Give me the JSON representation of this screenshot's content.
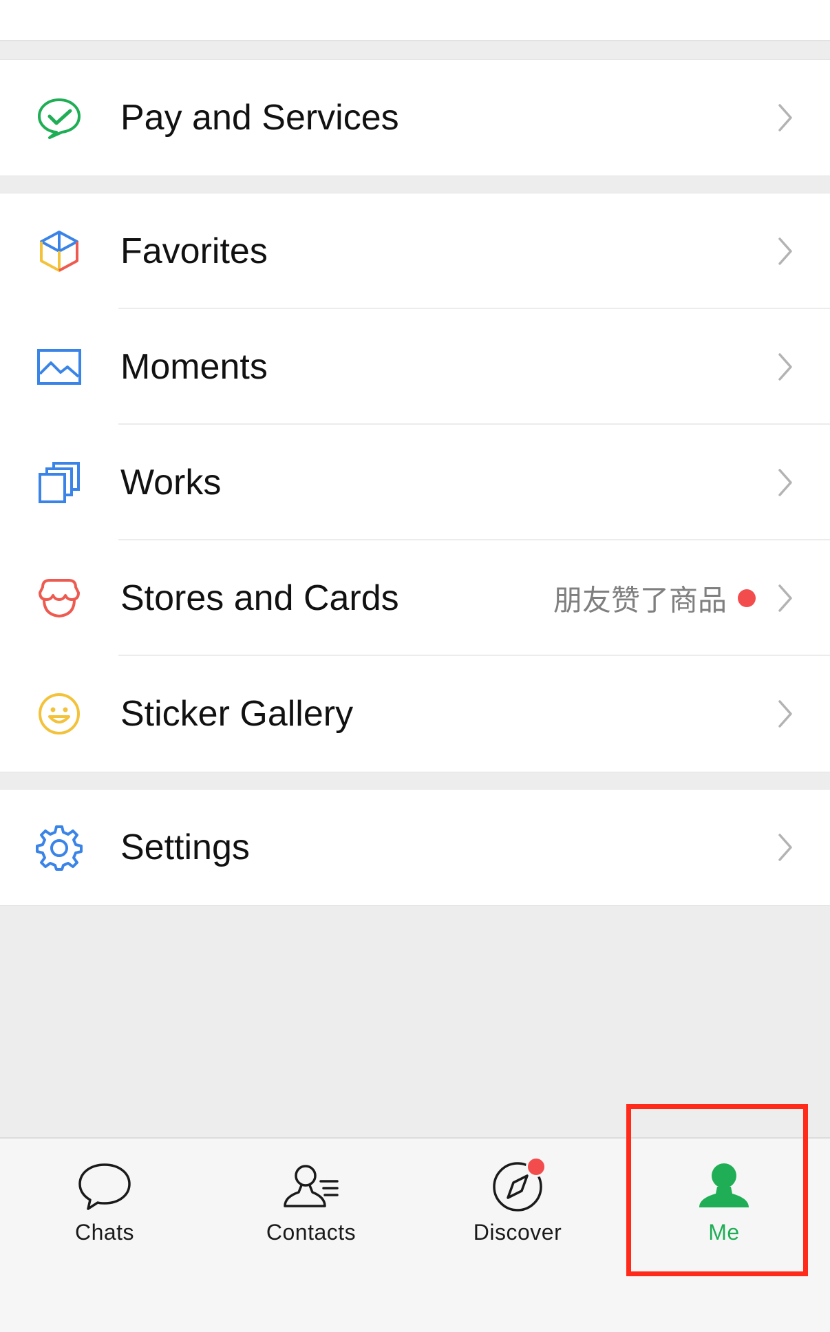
{
  "menu": {
    "pay": {
      "label": "Pay and Services"
    },
    "favorites": {
      "label": "Favorites"
    },
    "moments": {
      "label": "Moments"
    },
    "works": {
      "label": "Works"
    },
    "stores": {
      "label": "Stores and Cards",
      "subtext": "朋友赞了商品"
    },
    "stickers": {
      "label": "Sticker Gallery"
    },
    "settings": {
      "label": "Settings"
    }
  },
  "tabbar": {
    "chats": {
      "label": "Chats"
    },
    "contacts": {
      "label": "Contacts"
    },
    "discover": {
      "label": "Discover"
    },
    "me": {
      "label": "Me"
    }
  },
  "colors": {
    "accent": "#1fae55",
    "badge": "#f34c4c",
    "highlight": "#ff2a1a"
  },
  "icons": {
    "pay": "pay-services-icon",
    "favorites": "cube-icon",
    "moments": "image-icon",
    "works": "stacked-squares-icon",
    "stores": "store-icon",
    "stickers": "smiley-icon",
    "settings": "gear-icon",
    "chats": "speech-bubble-icon",
    "contacts": "contacts-icon",
    "discover": "compass-icon",
    "me": "person-icon"
  }
}
